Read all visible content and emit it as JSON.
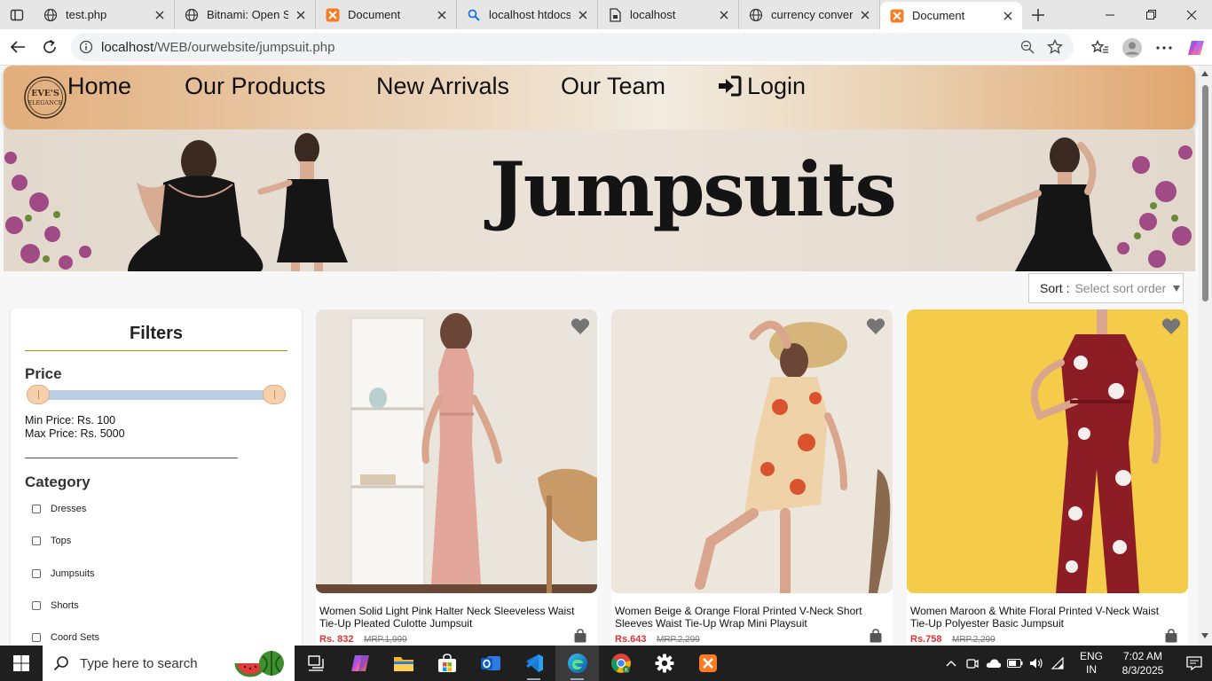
{
  "browser": {
    "tabs": [
      {
        "title": "test.php",
        "icon": "globe-icon"
      },
      {
        "title": "Bitnami: Open Sou",
        "icon": "globe-icon"
      },
      {
        "title": "Document",
        "icon": "xampp-icon"
      },
      {
        "title": "localhost htdocs ir",
        "icon": "search-icon"
      },
      {
        "title": "localhost",
        "icon": "file-lock-icon"
      },
      {
        "title": "currency converte",
        "icon": "globe-icon"
      },
      {
        "title": "Document",
        "icon": "xampp-icon",
        "active": true
      }
    ],
    "address": {
      "host": "localhost",
      "path": "/WEB/ourwebsite/jumpsuit.php"
    }
  },
  "site": {
    "logo_text": "EVE'S ELEGANCE",
    "nav": {
      "home": "Home",
      "products": "Our Products",
      "arrivals": "New Arrivals",
      "team": "Our Team",
      "login": "Login"
    },
    "banner_title": "Jumpsuits",
    "sort": {
      "label": "Sort :",
      "placeholder": "Select sort order"
    },
    "filters": {
      "title": "Filters",
      "price_title": "Price",
      "min_price": "Min Price: Rs. 100",
      "max_price": "Max Price: Rs. 5000",
      "category_title": "Category",
      "categories": [
        "Dresses",
        "Tops",
        "Jumpsuits",
        "Shorts",
        "Coord Sets"
      ]
    },
    "products": [
      {
        "name": "Women Solid Light Pink Halter Neck Sleeveless Waist Tie-Up Pleated Culotte Jumpsuit",
        "price": "Rs. 832",
        "mrp": "MRP.1,999",
        "bg": "#e9e4dc",
        "garment": "#e2a79a"
      },
      {
        "name": "Women Beige & Orange Floral Printed V-Neck Short Sleeves Waist Tie-Up Wrap Mini Playsuit",
        "price": "Rs.643",
        "mrp": "MRP.2,299",
        "bg": "#ece6dc",
        "garment": "#f0d2a8"
      },
      {
        "name": "Women Maroon & White Floral Printed V-Neck Waist Tie-Up Polyester Basic Jumpsuit",
        "price": "Rs.758",
        "mrp": "MRP.2,299",
        "bg": "#f5cc4a",
        "garment": "#8c1d24"
      }
    ]
  },
  "taskbar": {
    "search_placeholder": "Type here to search",
    "lang": "ENG",
    "region": "IN",
    "time": "7:02 AM",
    "date": "8/3/2025"
  }
}
